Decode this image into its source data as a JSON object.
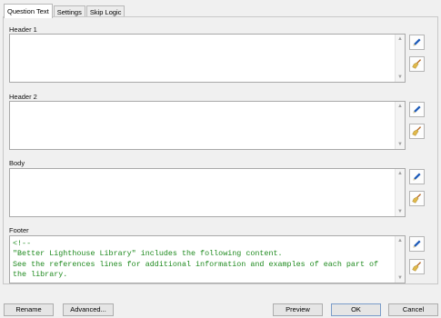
{
  "tabs": [
    {
      "label": "Question Text",
      "active": true
    },
    {
      "label": "Settings",
      "active": false
    },
    {
      "label": "Skip Logic",
      "active": false
    }
  ],
  "sections": [
    {
      "label": "Header 1",
      "text": ""
    },
    {
      "label": "Header 2",
      "text": ""
    },
    {
      "label": "Body",
      "text": ""
    },
    {
      "label": "Footer",
      "text": "<!--\n\"Better Lighthouse Library\" includes the following content.\nSee the references lines for additional information and examples of each part of\nthe library."
    }
  ],
  "icons": {
    "edit": "pencil-icon",
    "clear": "broom-icon"
  },
  "colors": {
    "code_text": "#1f8a1f",
    "pencil": "#1e5bb8",
    "broom_handle": "#b5651d",
    "broom_bristles": "#e0b84a"
  },
  "buttons": {
    "rename": "Rename",
    "advanced": "Advanced...",
    "preview": "Preview",
    "ok": "OK",
    "cancel": "Cancel"
  }
}
